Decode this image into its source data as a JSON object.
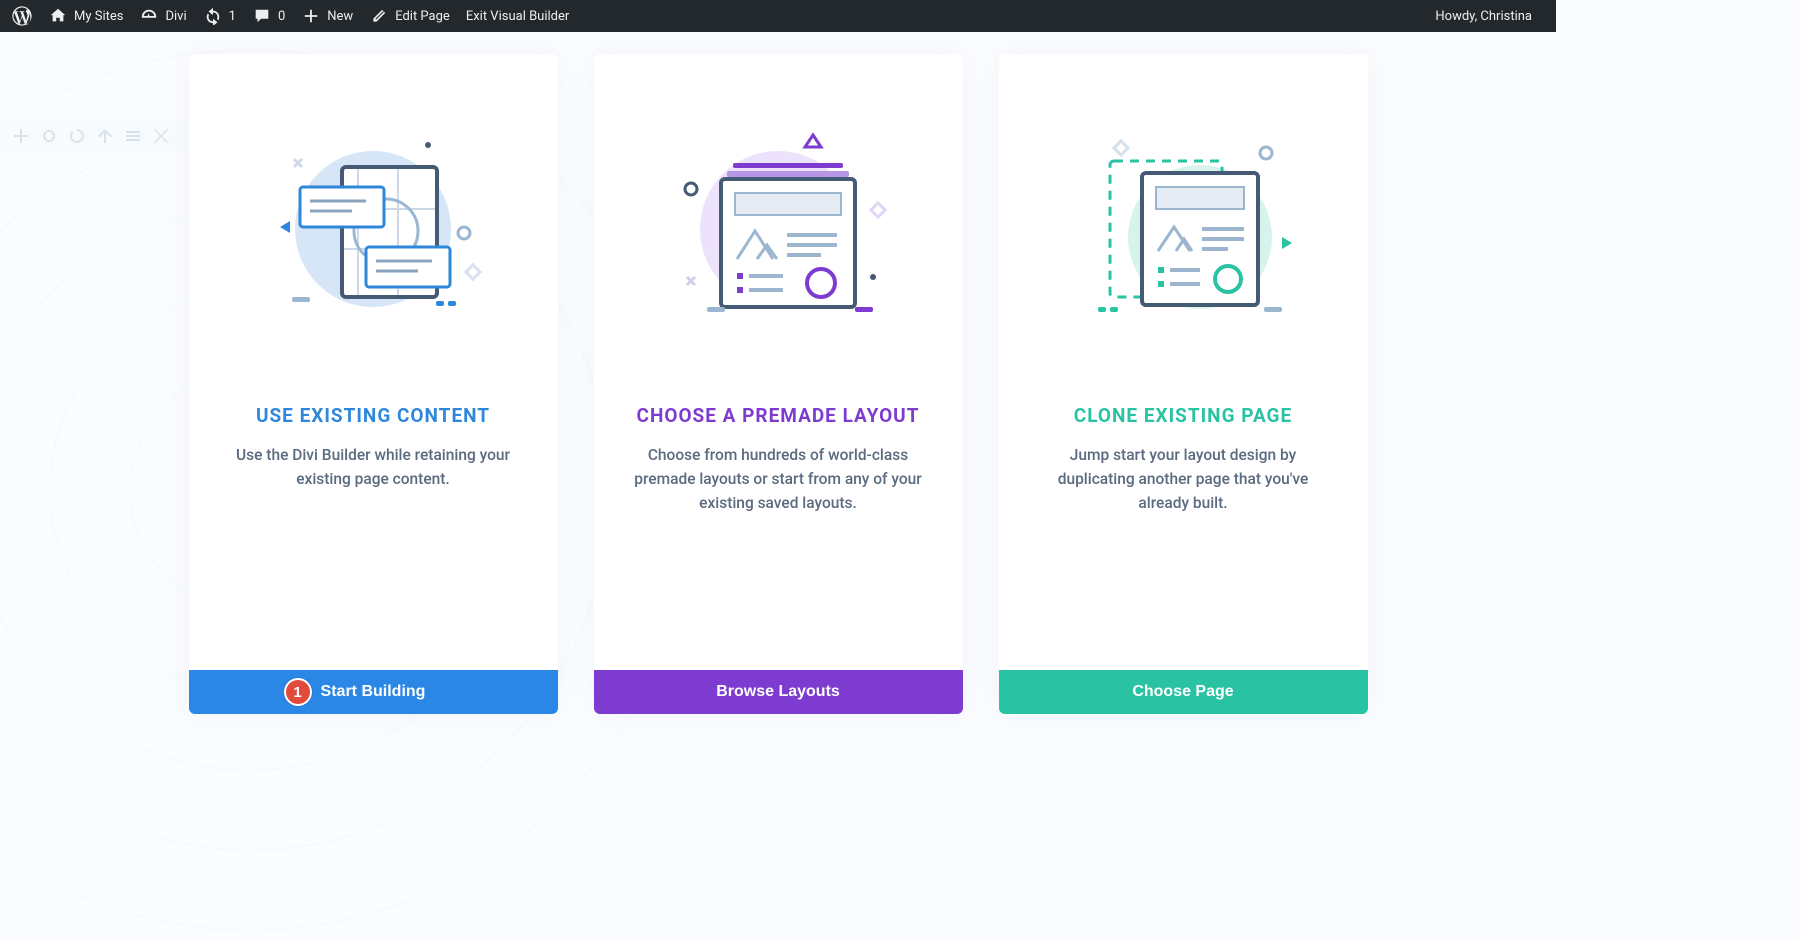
{
  "adminbar": {
    "my_sites": "My Sites",
    "site_name": "Divi",
    "updates_count": "1",
    "comments_count": "0",
    "new_label": "New",
    "edit_page": "Edit Page",
    "exit_vb": "Exit Visual Builder",
    "greeting": "Howdy, Christina"
  },
  "cards": [
    {
      "title": "USE EXISTING CONTENT",
      "desc": "Use the Divi Builder while retaining your existing page content.",
      "button": "Start Building",
      "badge": "1"
    },
    {
      "title": "CHOOSE A PREMADE LAYOUT",
      "desc": "Choose from hundreds of world-class premade layouts or start from any of your existing saved layouts.",
      "button": "Browse Layouts"
    },
    {
      "title": "CLONE EXISTING PAGE",
      "desc": "Jump start your layout design by duplicating another page that you've already built.",
      "button": "Choose Page"
    }
  ]
}
